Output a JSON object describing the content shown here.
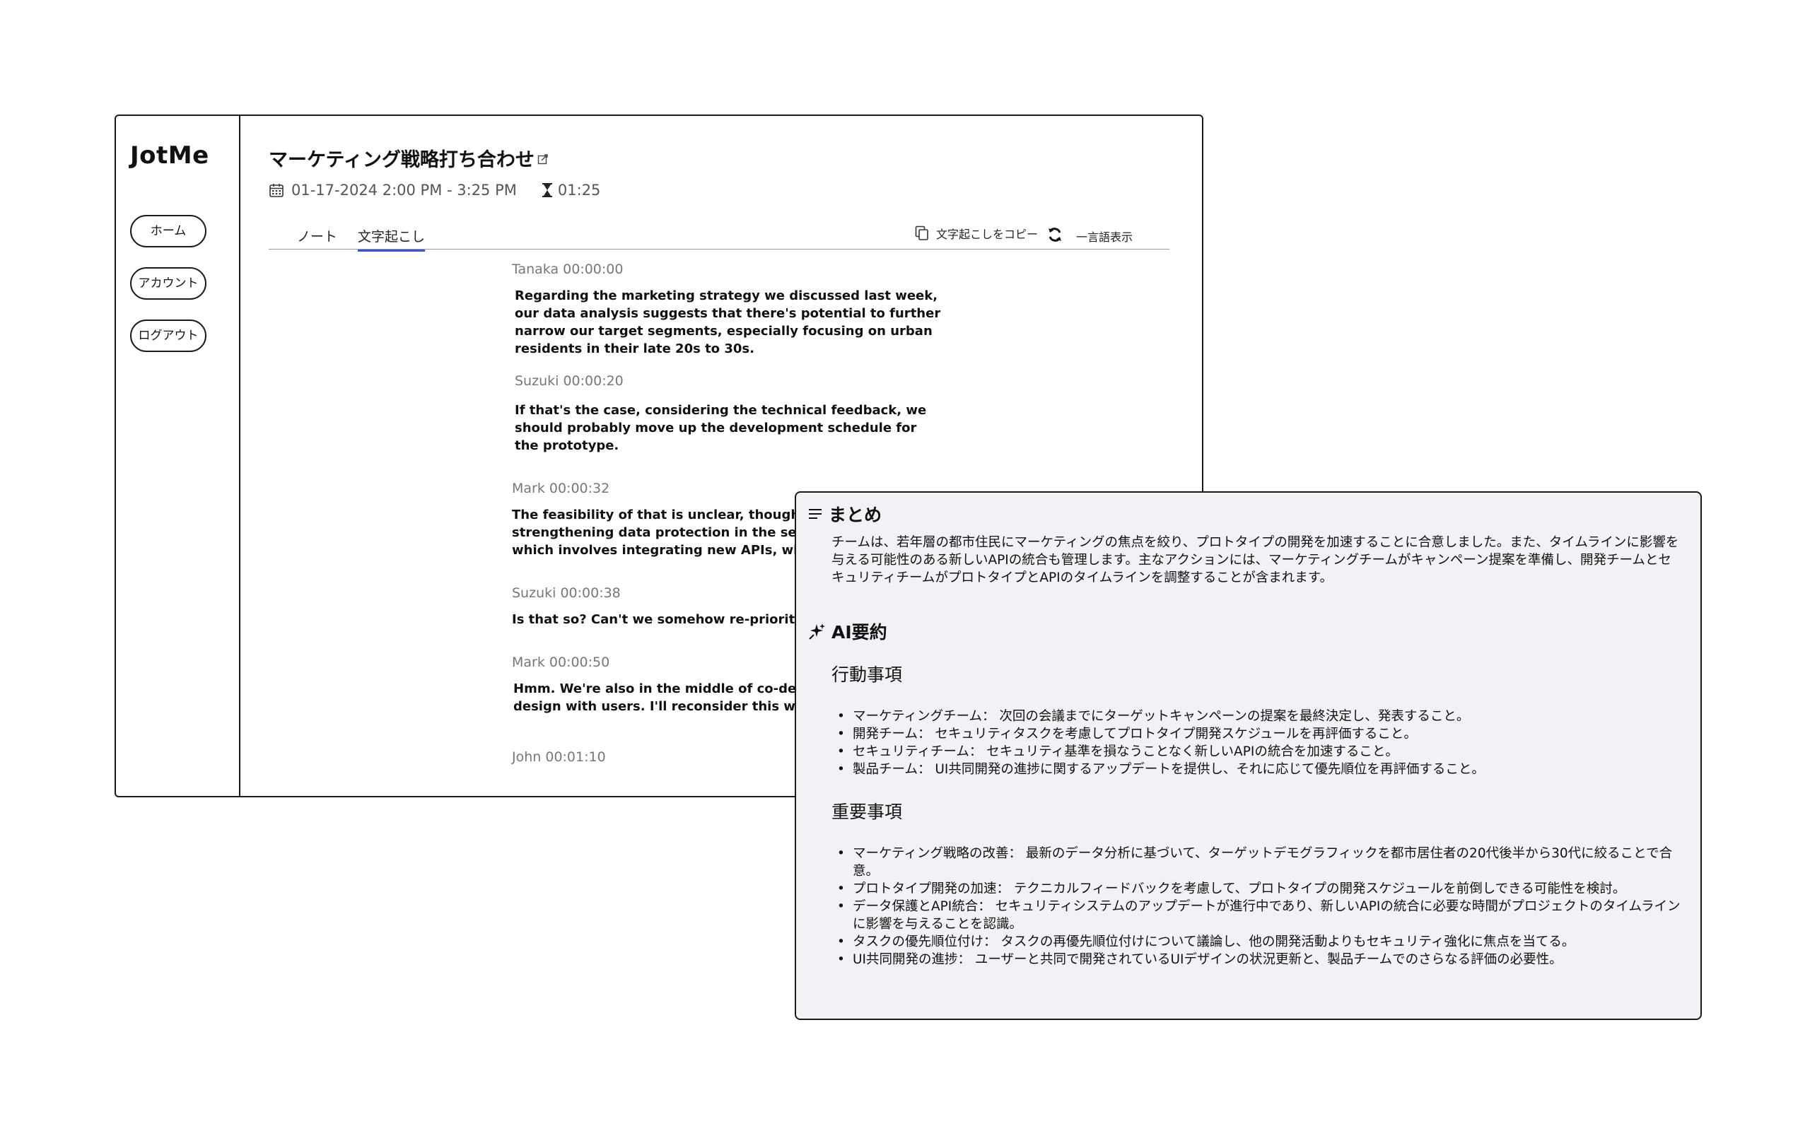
{
  "app": {
    "logo": "JotMe",
    "nav": [
      {
        "label": "ホーム"
      },
      {
        "label": "アカウント"
      },
      {
        "label": "ログアウト"
      }
    ]
  },
  "meeting": {
    "title": "マーケティング戦略打ち合わせ",
    "datetime": "01-17-2024 2:00 PM - 3:25 PM",
    "duration": "01:25"
  },
  "tabs": [
    {
      "label": "ノート",
      "active": false
    },
    {
      "label": "文字起こし",
      "active": true
    }
  ],
  "actions": {
    "copy_transcript": "文字起こしをコピー",
    "word_view": "一言語表示"
  },
  "transcript": [
    {
      "speaker": "Tanaka 00:00:00",
      "text": "Regarding the marketing strategy we discussed last week, our data analysis suggests that there's potential to further narrow our target segments, especially focusing on urban residents in their late 20s to 30s."
    },
    {
      "speaker": "Suzuki 00:00:20",
      "text": "If that's the case, considering the technical feedback, we should probably move up the development schedule for the prototype."
    },
    {
      "speaker": "Mark 00:00:32",
      "text": "The feasibility of that is unclear, though. We're strengthening data protection in the security system, which involves integrating new APIs, which could"
    },
    {
      "speaker": "Suzuki 00:00:38",
      "text": "Is that so? Can't we somehow re-prioritize"
    },
    {
      "speaker": "Mark 00:00:50",
      "text": "Hmm. We're also in the middle of co-developing the UI design with users. I'll reconsider this with the"
    },
    {
      "speaker": "John 00:01:10",
      "text": ""
    }
  ],
  "summary": {
    "heading": "まとめ",
    "icon": "menu-lines-icon",
    "text": "チームは、若年層の都市住民にマーケティングの焦点を絞り、プロトタイプの開発を加速することに合意しました。また、タイムラインに影響を与える可能性のある新しいAPIの統合も管理します。主なアクションには、マーケティングチームがキャンペーン提案を準備し、開発チームとセキュリティチームがプロトタイプとAPIのタイムラインを調整することが含まれます。"
  },
  "ai_summary": {
    "heading": "AI要約",
    "icon": "sparkle-icon",
    "action_items_heading": "行動事項",
    "action_items": [
      "マーケティングチーム： 次回の会議までにターゲットキャンペーンの提案を最終決定し、発表すること。",
      "開発チーム： セキュリティタスクを考慮してプロトタイプ開発スケジュールを再評価すること。",
      "セキュリティチーム： セキュリティ基準を損なうことなく新しいAPIの統合を加速すること。",
      "製品チーム： UI共同開発の進捗に関するアップデートを提供し、それに応じて優先順位を再評価すること。"
    ],
    "key_points_heading": "重要事項",
    "key_points": [
      "マーケティング戦略の改善： 最新のデータ分析に基づいて、ターゲットデモグラフィックを都市居住者の20代後半から30代に絞ることで合意。",
      "プロトタイプ開発の加速： テクニカルフィードバックを考慮して、プロトタイプの開発スケジュールを前倒しできる可能性を検討。",
      "データ保護とAPI統合： セキュリティシステムのアップデートが進行中であり、新しいAPIの統合に必要な時間がプロジェクトのタイムラインに影響を与えることを認識。",
      "タスクの優先順位付け： タスクの再優先順位付けについて議論し、他の開発活動よりもセキュリティ強化に焦点を当てる。",
      "UI共同開発の進捗： ユーザーと共同で開発されているUIデザインの状況更新と、製品チームでのさらなる評価の必要性。"
    ]
  },
  "colors": {
    "accent": "#4050c8",
    "panel_bg": "#f2f1f5",
    "border": "#1a1a1a"
  }
}
